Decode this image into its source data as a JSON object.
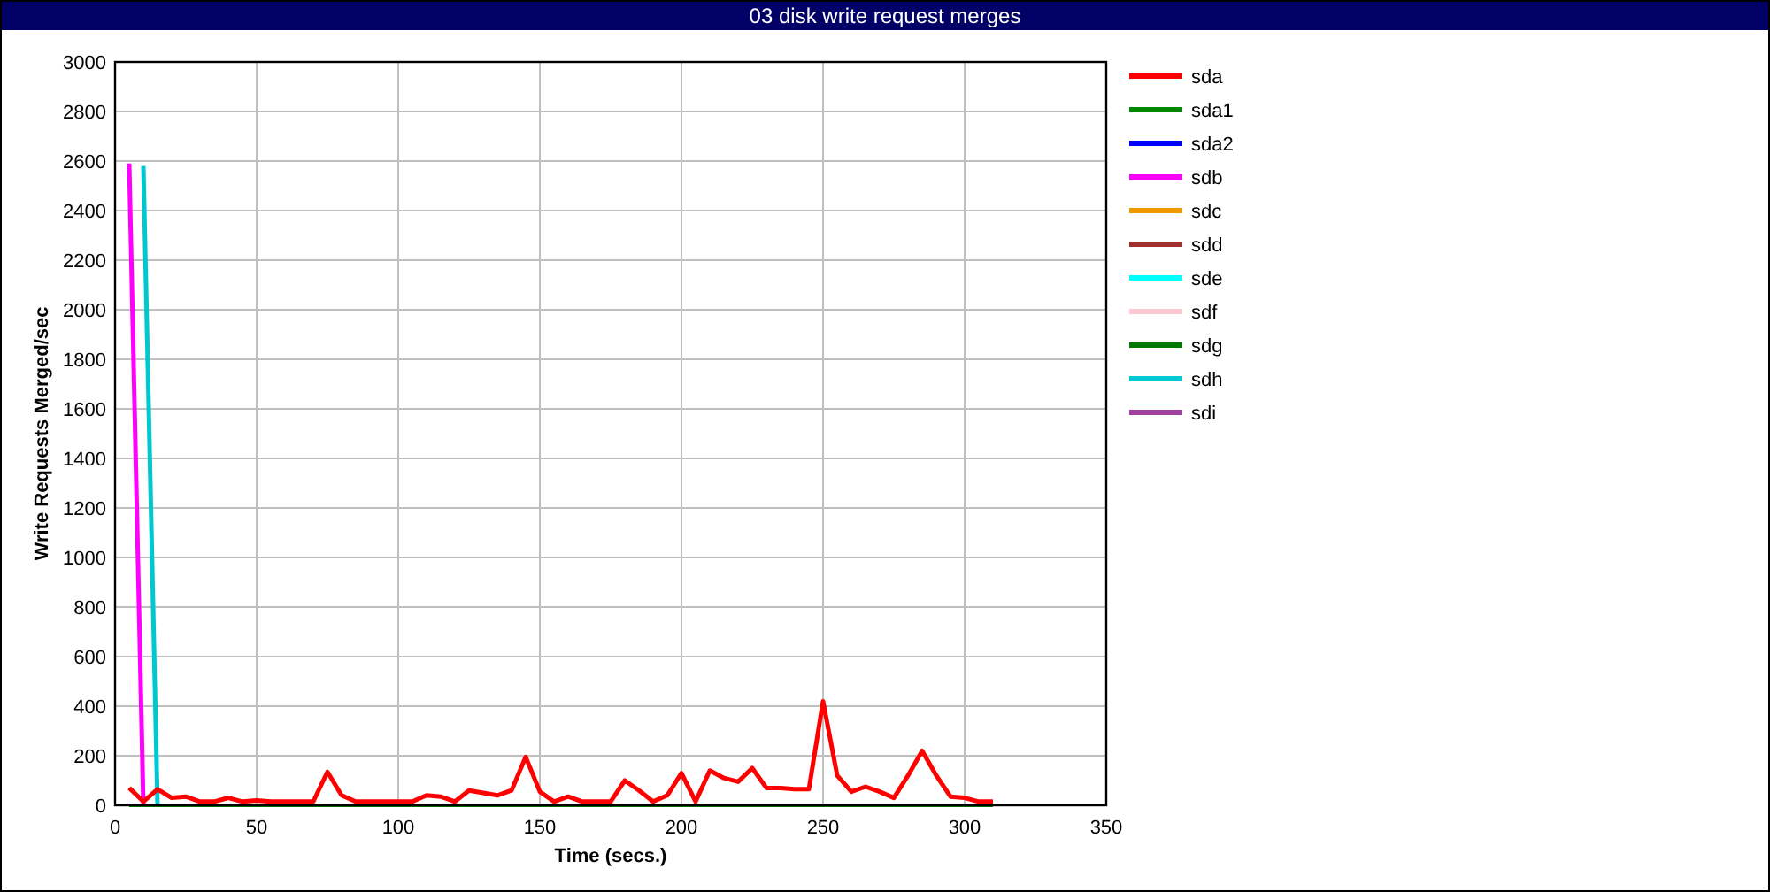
{
  "window": {
    "title": "03 disk write request merges"
  },
  "chart_data": {
    "type": "line",
    "xlabel": "Time (secs.)",
    "ylabel": "Write Requests Merged/sec",
    "xlim": [
      0,
      350
    ],
    "ylim": [
      0,
      3000
    ],
    "xticks": [
      0,
      50,
      100,
      150,
      200,
      250,
      300,
      350
    ],
    "yticks": [
      0,
      200,
      400,
      600,
      800,
      1000,
      1200,
      1400,
      1600,
      1800,
      2000,
      2200,
      2400,
      2600,
      2800,
      3000
    ],
    "grid": true,
    "legend": true,
    "x": [
      5,
      10,
      15,
      20,
      25,
      30,
      35,
      40,
      45,
      50,
      55,
      60,
      65,
      70,
      75,
      80,
      85,
      90,
      95,
      100,
      105,
      110,
      115,
      120,
      125,
      130,
      135,
      140,
      145,
      150,
      155,
      160,
      165,
      170,
      175,
      180,
      185,
      190,
      195,
      200,
      205,
      210,
      215,
      220,
      225,
      230,
      235,
      240,
      245,
      250,
      255,
      260,
      265,
      270,
      275,
      280,
      285,
      290,
      295,
      300,
      305,
      310
    ],
    "series": [
      {
        "name": "sda",
        "color": "#ff0000",
        "values": [
          70,
          15,
          65,
          30,
          35,
          15,
          15,
          30,
          15,
          20,
          15,
          15,
          15,
          15,
          135,
          40,
          15,
          15,
          15,
          15,
          15,
          40,
          35,
          15,
          60,
          50,
          40,
          60,
          195,
          55,
          15,
          35,
          15,
          15,
          15,
          100,
          60,
          15,
          40,
          130,
          15,
          140,
          110,
          95,
          150,
          70,
          70,
          65,
          65,
          420,
          120,
          55,
          75,
          55,
          30,
          120,
          220,
          120,
          35,
          30,
          15,
          15
        ]
      },
      {
        "name": "sda1",
        "color": "#008800",
        "values": [
          0,
          0,
          0,
          0,
          0,
          0,
          0,
          0,
          0,
          0,
          0,
          0,
          0,
          0,
          0,
          0,
          0,
          0,
          0,
          0,
          0,
          0,
          0,
          0,
          0,
          0,
          0,
          0,
          0,
          0,
          0,
          0,
          0,
          0,
          0,
          0,
          0,
          0,
          0,
          0,
          0,
          0,
          0,
          0,
          0,
          0,
          0,
          0,
          0,
          0,
          0,
          0,
          0,
          0,
          0,
          0,
          0,
          0,
          0,
          0,
          0,
          0
        ]
      },
      {
        "name": "sda2",
        "color": "#0000ff",
        "values": [
          null,
          null,
          null,
          null,
          null,
          null,
          null,
          null,
          null,
          null,
          null,
          null,
          null,
          null,
          null,
          null,
          null,
          null,
          null,
          null,
          null,
          null,
          null,
          null,
          null,
          null,
          null,
          null,
          null,
          null,
          null,
          null,
          null,
          null,
          null,
          null,
          null,
          null,
          null,
          null,
          null,
          null,
          null,
          null,
          null,
          null,
          null,
          null,
          null,
          null,
          null,
          null,
          null,
          null,
          null,
          null,
          null,
          null,
          null,
          null,
          null,
          null
        ]
      },
      {
        "name": "sdb",
        "color": "#ff00ff",
        "values": [
          2590,
          0,
          null,
          null,
          null,
          null,
          null,
          null,
          null,
          null,
          null,
          null,
          null,
          null,
          null,
          null,
          null,
          null,
          null,
          null,
          null,
          null,
          null,
          null,
          null,
          null,
          null,
          null,
          null,
          null,
          null,
          null,
          null,
          null,
          null,
          null,
          null,
          null,
          null,
          null,
          null,
          null,
          null,
          null,
          null,
          null,
          null,
          null,
          null,
          null,
          null,
          null,
          null,
          null,
          null,
          null,
          null,
          null,
          null,
          null,
          null,
          null
        ]
      },
      {
        "name": "sdc",
        "color": "#ee9900",
        "values": [
          null,
          null,
          null,
          null,
          null,
          null,
          null,
          null,
          null,
          null,
          null,
          null,
          null,
          null,
          null,
          null,
          null,
          null,
          null,
          null,
          null,
          null,
          null,
          null,
          null,
          null,
          null,
          null,
          null,
          null,
          null,
          null,
          null,
          null,
          null,
          null,
          null,
          null,
          null,
          null,
          null,
          null,
          null,
          null,
          null,
          null,
          null,
          null,
          null,
          null,
          null,
          null,
          null,
          null,
          null,
          null,
          null,
          null,
          null,
          null,
          null,
          null
        ]
      },
      {
        "name": "sdd",
        "color": "#a03030",
        "values": [
          null,
          null,
          null,
          null,
          null,
          null,
          null,
          null,
          null,
          null,
          null,
          null,
          null,
          null,
          null,
          null,
          null,
          null,
          null,
          null,
          null,
          null,
          null,
          null,
          null,
          null,
          null,
          null,
          null,
          null,
          null,
          null,
          null,
          null,
          null,
          null,
          null,
          null,
          null,
          null,
          null,
          null,
          null,
          null,
          null,
          null,
          null,
          null,
          null,
          null,
          null,
          null,
          null,
          null,
          null,
          null,
          null,
          null,
          null,
          null,
          null,
          null
        ]
      },
      {
        "name": "sde",
        "color": "#00ffff",
        "values": [
          null,
          null,
          null,
          null,
          null,
          null,
          null,
          null,
          null,
          null,
          null,
          null,
          null,
          null,
          null,
          null,
          null,
          null,
          null,
          null,
          null,
          null,
          null,
          null,
          null,
          null,
          null,
          null,
          null,
          null,
          null,
          null,
          null,
          null,
          null,
          null,
          null,
          null,
          null,
          null,
          null,
          null,
          null,
          null,
          null,
          null,
          null,
          null,
          null,
          null,
          null,
          null,
          null,
          null,
          null,
          null,
          null,
          null,
          null,
          null,
          null,
          null
        ]
      },
      {
        "name": "sdf",
        "color": "#ffc8d0",
        "values": [
          null,
          null,
          null,
          null,
          null,
          null,
          null,
          null,
          null,
          null,
          null,
          null,
          null,
          null,
          null,
          null,
          null,
          null,
          null,
          null,
          null,
          null,
          null,
          null,
          null,
          null,
          null,
          null,
          null,
          null,
          null,
          null,
          null,
          null,
          null,
          null,
          null,
          null,
          null,
          null,
          null,
          null,
          null,
          null,
          null,
          null,
          null,
          null,
          null,
          null,
          null,
          null,
          null,
          null,
          null,
          null,
          null,
          null,
          null,
          null,
          null,
          null
        ]
      },
      {
        "name": "sdg",
        "color": "#007700",
        "values": [
          null,
          null,
          null,
          null,
          null,
          null,
          null,
          null,
          null,
          null,
          null,
          null,
          null,
          null,
          null,
          null,
          null,
          null,
          null,
          null,
          null,
          null,
          null,
          null,
          null,
          null,
          null,
          null,
          null,
          null,
          null,
          null,
          null,
          null,
          null,
          null,
          null,
          null,
          null,
          null,
          null,
          null,
          null,
          null,
          null,
          null,
          null,
          null,
          null,
          null,
          null,
          null,
          null,
          null,
          null,
          null,
          null,
          null,
          null,
          null,
          null,
          null
        ]
      },
      {
        "name": "sdh",
        "color": "#00c8d0",
        "values": [
          null,
          2580,
          0,
          null,
          null,
          null,
          null,
          null,
          null,
          null,
          null,
          null,
          null,
          null,
          null,
          null,
          null,
          null,
          null,
          null,
          null,
          null,
          null,
          null,
          null,
          null,
          null,
          null,
          null,
          null,
          null,
          null,
          null,
          null,
          null,
          null,
          null,
          null,
          null,
          null,
          null,
          null,
          null,
          null,
          null,
          null,
          null,
          null,
          null,
          null,
          null,
          null,
          null,
          null,
          null,
          null,
          null,
          null,
          null,
          null,
          null,
          null
        ]
      },
      {
        "name": "sdi",
        "color": "#a040a0",
        "values": [
          null,
          null,
          null,
          null,
          null,
          null,
          null,
          null,
          null,
          null,
          null,
          null,
          null,
          null,
          null,
          null,
          null,
          null,
          null,
          null,
          null,
          null,
          null,
          null,
          null,
          null,
          null,
          null,
          null,
          null,
          null,
          null,
          null,
          null,
          null,
          null,
          null,
          null,
          null,
          null,
          null,
          null,
          null,
          null,
          null,
          null,
          null,
          null,
          null,
          null,
          null,
          null,
          null,
          null,
          null,
          null,
          null,
          null,
          null,
          null,
          null,
          null
        ]
      }
    ]
  }
}
